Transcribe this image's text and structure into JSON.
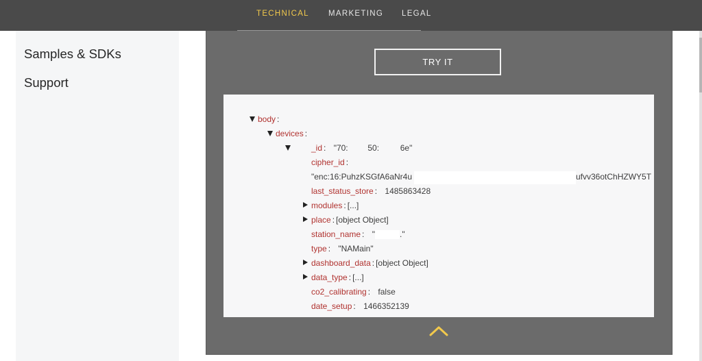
{
  "nav": {
    "items": [
      {
        "label": "TECHNICAL",
        "active": true
      },
      {
        "label": "MARKETING",
        "active": false
      },
      {
        "label": "LEGAL",
        "active": false
      }
    ],
    "active_color": "#f2c94c"
  },
  "sidebar": {
    "items": [
      {
        "label": "Samples & SDKs"
      },
      {
        "label": "Support"
      }
    ]
  },
  "panel": {
    "try_button": "TRY IT",
    "collapse_icon": "chevron-up-icon",
    "accent_color": "#f2c94c"
  },
  "json_view": {
    "body_key": "body",
    "devices_key": "devices",
    "fields": {
      "id": {
        "key": "_id",
        "value_a": "\"70:",
        "value_b": "50:",
        "value_c": "6e\""
      },
      "cipher_id": {
        "key": "cipher_id",
        "value_a": "\"enc:16:PuhzKSGfA6aNr4u",
        "value_b": "ufvv36otChHZWY5T"
      },
      "last_status_store": {
        "key": "last_status_store",
        "value": "1485863428"
      },
      "modules": {
        "key": "modules",
        "value": "[...]"
      },
      "place": {
        "key": "place",
        "value": "[object Object]"
      },
      "station_name": {
        "key": "station_name",
        "value_a": "\"",
        "value_b": ".\""
      },
      "type": {
        "key": "type",
        "value": "\"NAMain\""
      },
      "dashboard_data": {
        "key": "dashboard_data",
        "value": "[object Object]"
      },
      "data_type": {
        "key": "data_type",
        "value": "[...]"
      },
      "co2_calibrating": {
        "key": "co2_calibrating",
        "value": "false"
      },
      "date_setup": {
        "key": "date_setup",
        "value": "1466352139"
      }
    }
  }
}
